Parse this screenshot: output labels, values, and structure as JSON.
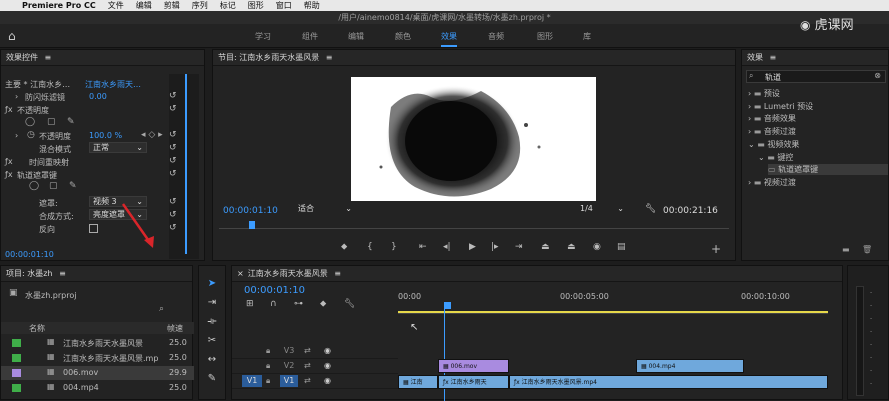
{
  "menubar": {
    "apple": "",
    "app": "Premiere Pro CC",
    "items": [
      "文件",
      "编辑",
      "剪辑",
      "序列",
      "标记",
      "图形",
      "窗口",
      "帮助"
    ]
  },
  "window_title": "/用户/ainemo0814/桌面/虎课网/水墨转场/水墨zh.prproj *",
  "workspaces": [
    "学习",
    "组件",
    "编辑",
    "颜色",
    "效果",
    "音频",
    "图形",
    "库"
  ],
  "active_workspace": "效果",
  "watermark": "虎课网",
  "effect_controls": {
    "title": "效果控件",
    "clip_path": "主要 * 江南水乡…",
    "clip_path2": "江南水乡雨天…",
    "flicker_label": "防闪烁滤镜",
    "flicker_value": "0.00",
    "opacity_section": "不透明度",
    "opacity_label": "不透明度",
    "opacity_value": "100.0 %",
    "blend_label": "混合模式",
    "blend_value": "正常",
    "time_remap": "时间重映射",
    "track_matte": "轨道遮罩键",
    "matte_label": "遮罩:",
    "matte_value": "视频 3",
    "composite_label": "合成方式:",
    "composite_value": "亮度遮罩",
    "reverse_label": "反向",
    "timecode": "00:00:01:10"
  },
  "program": {
    "title": "节目: 江南水乡雨天水墨风景",
    "timecode": "00:00:01:10",
    "fit": "适合",
    "quality": "1/4",
    "duration": "00:00:21:16"
  },
  "effects_panel": {
    "title": "效果",
    "search_value": "轨道",
    "tree": [
      {
        "label": "预设",
        "level": 0,
        "open": false
      },
      {
        "label": "Lumetri 预设",
        "level": 0,
        "open": false
      },
      {
        "label": "音频效果",
        "level": 0,
        "open": false
      },
      {
        "label": "音频过渡",
        "level": 0,
        "open": false
      },
      {
        "label": "视频效果",
        "level": 0,
        "open": true
      },
      {
        "label": "键控",
        "level": 1,
        "open": true
      },
      {
        "label": "轨道遮罩键",
        "level": 2,
        "open": false
      },
      {
        "label": "视频过渡",
        "level": 0,
        "open": false
      }
    ]
  },
  "project": {
    "title": "项目: 水墨zh",
    "file": "水墨zh.prproj",
    "col_name": "名称",
    "col_rate": "帧速",
    "items": [
      {
        "name": "江南水乡雨天水墨风景",
        "rate": "25.0",
        "color": "#3fae49"
      },
      {
        "name": "江南水乡雨天水墨风景.mp",
        "rate": "25.0",
        "color": "#3fae49"
      },
      {
        "name": "006.mov",
        "rate": "29.9",
        "color": "#a98be0"
      },
      {
        "name": "004.mp4",
        "rate": "25.0",
        "color": "#3fae49"
      }
    ]
  },
  "timeline": {
    "title": "江南水乡雨天水墨风景",
    "timecode": "00:00:01:10",
    "ruler": [
      "00:00",
      "00:00:05:00",
      "00:00:10:00"
    ],
    "tracks": [
      "V3",
      "V2",
      "V1"
    ],
    "source_patch": "V1",
    "clips": {
      "v2a": "006.mov",
      "v2b": "004.mp4",
      "v1a": "江南",
      "v1b": "江南水乡雨天",
      "v1c": "江南水乡雨天水墨风景.mp4"
    }
  },
  "colors": {
    "accent": "#3c9cff",
    "purple_clip": "#a98be0",
    "blue_clip": "#6fa8dc",
    "playhead": "#3c9cff"
  }
}
